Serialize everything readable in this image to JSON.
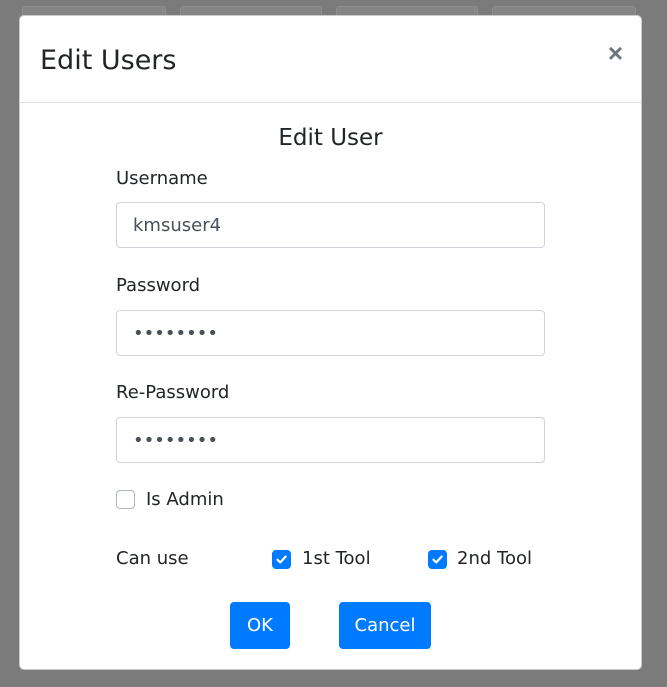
{
  "modal": {
    "title": "Edit Users",
    "close_glyph": "×"
  },
  "form": {
    "heading": "Edit User",
    "username": {
      "label": "Username",
      "value": "kmsuser4"
    },
    "password": {
      "label": "Password",
      "value": "••••••••"
    },
    "repassword": {
      "label": "Re-Password",
      "value": "••••••••"
    },
    "is_admin": {
      "label": "Is Admin",
      "checked": false
    },
    "can_use": {
      "label": "Can use",
      "tools": [
        {
          "label": "1st Tool",
          "checked": true
        },
        {
          "label": "2nd Tool",
          "checked": true
        }
      ]
    }
  },
  "buttons": {
    "ok_label": "OK",
    "cancel_label": "Cancel"
  },
  "colors": {
    "primary": "#007bff",
    "backdrop": "#7b7b7b"
  },
  "icons": {
    "close": "close-icon",
    "check": "check-icon"
  }
}
